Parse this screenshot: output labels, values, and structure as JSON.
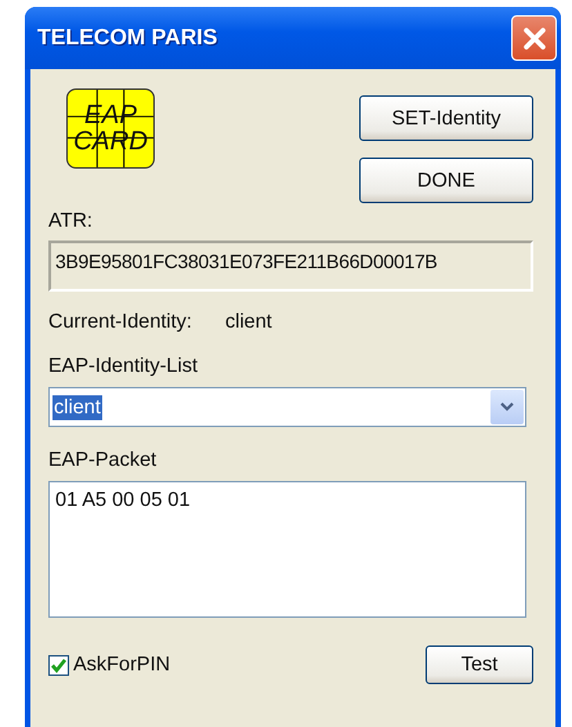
{
  "window": {
    "title": "TELECOM PARIS"
  },
  "logo": {
    "lines": [
      "EAP",
      "CARD"
    ]
  },
  "buttons": [
    {
      "label": "SET-Identity"
    },
    {
      "label": "DONE"
    }
  ],
  "atr": {
    "label": "ATR:",
    "value": "3B9E95801FC38031E073FE211B66D00017B"
  },
  "current_identity": {
    "label": "Current-Identity:",
    "value": "client"
  },
  "identity_list": {
    "label": "EAP-Identity-List",
    "value": "client",
    "selected": true
  },
  "packet": {
    "label": "EAP-Packet",
    "value": "01 A5 00 05 01"
  },
  "ask_for_pin": {
    "label": "AskForPIN",
    "checked": true
  },
  "test_button": {
    "label": "Test"
  }
}
